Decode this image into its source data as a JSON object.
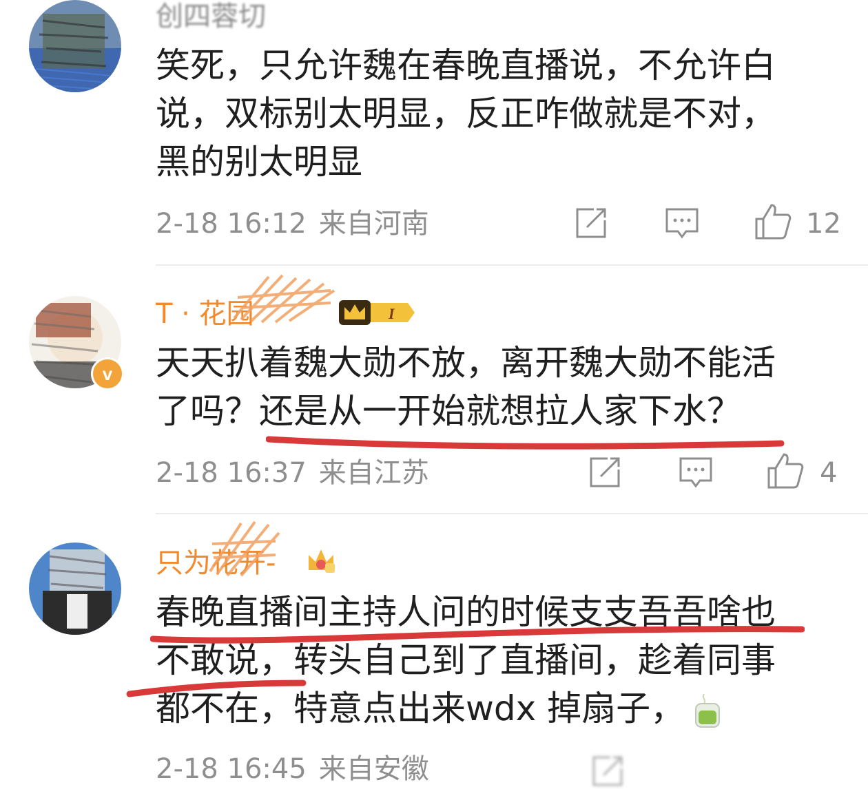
{
  "comments": [
    {
      "username": "创四蓉切",
      "text_lines": [
        "笑死，只允许魏在春晚直播说，不允许白",
        "说，双标别太明显，反正咋做就是不对，",
        "黑的别太明显"
      ],
      "time": "2-18 16:12",
      "location": "来自河南",
      "like_count": "12"
    },
    {
      "username": "T · 花园",
      "level_badge": "I",
      "text_lines": [
        "天天扒着魏大勋不放，离开魏大勋不能活",
        "了吗？还是从一开始就想拉人家下水？"
      ],
      "time": "2-18 16:37",
      "location": "来自江苏",
      "like_count": "4"
    },
    {
      "username": "只为花开-",
      "text_lines": [
        "春晚直播间主持人问的时候支支吾吾啥也",
        "不敢说，转头自己到了直播间，趁着同事",
        "都不在，特意点出来wdx 掉扇子，"
      ],
      "time": "2-18 16:45",
      "location": "来自安徽"
    }
  ],
  "icons": {
    "share": "share-icon",
    "comment": "comment-icon",
    "like": "thumbs-up-icon",
    "verified": "verified-v-badge-icon",
    "crown": "crown-icon",
    "tea": "tea-cup-emoji-icon"
  },
  "colors": {
    "username_highlight": "#f08a2c",
    "meta_gray": "#8e8e8e",
    "underline_red": "#d83a3a"
  }
}
